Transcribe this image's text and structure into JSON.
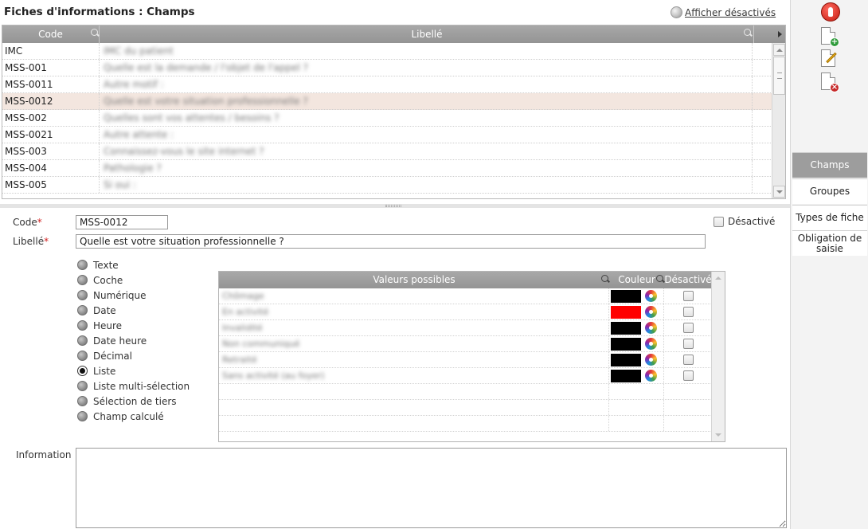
{
  "header": {
    "title": "Fiches d'informations : Champs",
    "show_disabled_label": "Afficher désactivés"
  },
  "grid": {
    "columns": [
      "Code",
      "Libellé"
    ],
    "rows": [
      {
        "code": "IMC",
        "libelle": "IMC du patient"
      },
      {
        "code": "MSS-001",
        "libelle": "Quelle est la demande / l'objet de l'appel ?"
      },
      {
        "code": "MSS-0011",
        "libelle": "Autre motif :"
      },
      {
        "code": "MSS-0012",
        "libelle": "Quelle est votre situation professionnelle ?"
      },
      {
        "code": "MSS-002",
        "libelle": "Quelles sont vos attentes / besoins ?"
      },
      {
        "code": "MSS-0021",
        "libelle": "Autre attente :"
      },
      {
        "code": "MSS-003",
        "libelle": "Connaissez-vous le site internet ?"
      },
      {
        "code": "MSS-004",
        "libelle": "Pathologie ?"
      },
      {
        "code": "MSS-005",
        "libelle": "Si oui :"
      }
    ],
    "selected_index": 3
  },
  "form": {
    "code_label": "Code",
    "code_value": "MSS-0012",
    "libelle_label": "Libellé",
    "libelle_value": "Quelle est votre situation professionnelle ?",
    "disabled_label": "Désactivé",
    "information_label": "Information",
    "information_value": "",
    "types": [
      {
        "label": "Texte",
        "checked": false
      },
      {
        "label": "Coche",
        "checked": false
      },
      {
        "label": "Numérique",
        "checked": false
      },
      {
        "label": "Date",
        "checked": false
      },
      {
        "label": "Heure",
        "checked": false
      },
      {
        "label": "Date heure",
        "checked": false
      },
      {
        "label": "Décimal",
        "checked": false
      },
      {
        "label": "Liste",
        "checked": true
      },
      {
        "label": "Liste multi-sélection",
        "checked": false
      },
      {
        "label": "Sélection de tiers",
        "checked": false
      },
      {
        "label": "Champ calculé",
        "checked": false
      }
    ]
  },
  "values_grid": {
    "columns": [
      "Valeurs possibles",
      "Couleur",
      "Désactivé"
    ],
    "rows": [
      {
        "label": "Chômage",
        "color": "#000000"
      },
      {
        "label": "En activité",
        "color": "#ff0000"
      },
      {
        "label": "Invalidité",
        "color": "#000000"
      },
      {
        "label": "Non communiqué",
        "color": "#000000"
      },
      {
        "label": "Retraité",
        "color": "#000000"
      },
      {
        "label": "Sans activité (au foyer)",
        "color": "#000000"
      }
    ],
    "empty_rows": 3
  },
  "sidebar": {
    "tabs": [
      {
        "label": "Champs",
        "active": true
      },
      {
        "label": "Groupes",
        "active": false
      },
      {
        "label": "Types de fiche",
        "active": false
      },
      {
        "label": "Obligation de saisie",
        "active": false
      }
    ]
  },
  "toolbar": {
    "icons": [
      "stop-icon",
      "new-document-icon",
      "edit-document-icon",
      "delete-document-icon"
    ]
  }
}
